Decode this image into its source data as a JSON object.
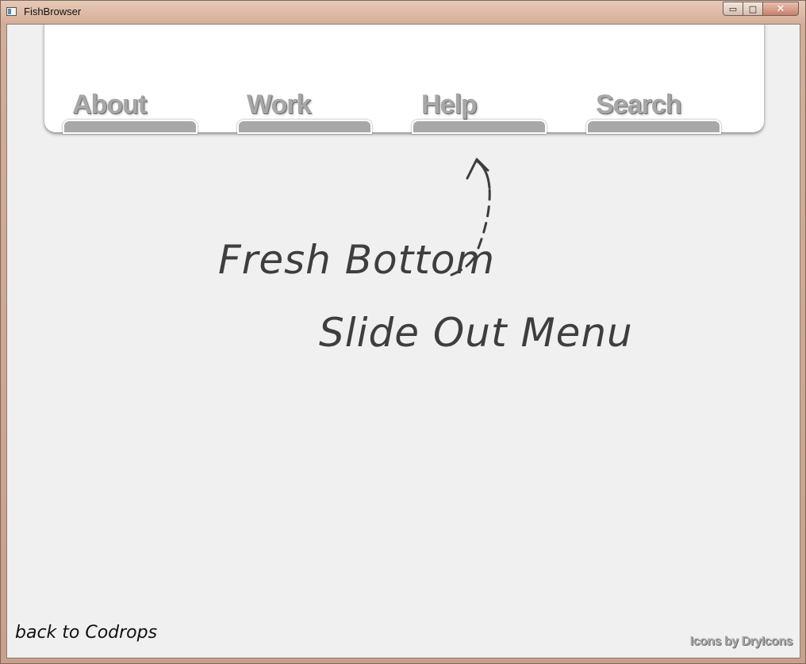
{
  "window": {
    "title": "FishBrowser",
    "minimize_glyph": "▭",
    "maximize_glyph": "□",
    "close_glyph": "✕"
  },
  "menu": {
    "items": [
      {
        "label": "About"
      },
      {
        "label": "Work"
      },
      {
        "label": "Help"
      },
      {
        "label": "Search"
      }
    ]
  },
  "headline": {
    "line1": "Fresh Bottom",
    "line2": "Slide Out Menu"
  },
  "footer": {
    "back_link": "back to Codrops",
    "credits": "Icons by DryIcons"
  },
  "colors": {
    "menu_text": "#a7a7a7",
    "menu_tab": "#a8a8a8",
    "content_bg": "#f0f0f0",
    "handwriting": "#3e3e3e"
  },
  "icons": {
    "app": "app-window-icon",
    "arrow": "curved-dashed-arrow-icon"
  }
}
